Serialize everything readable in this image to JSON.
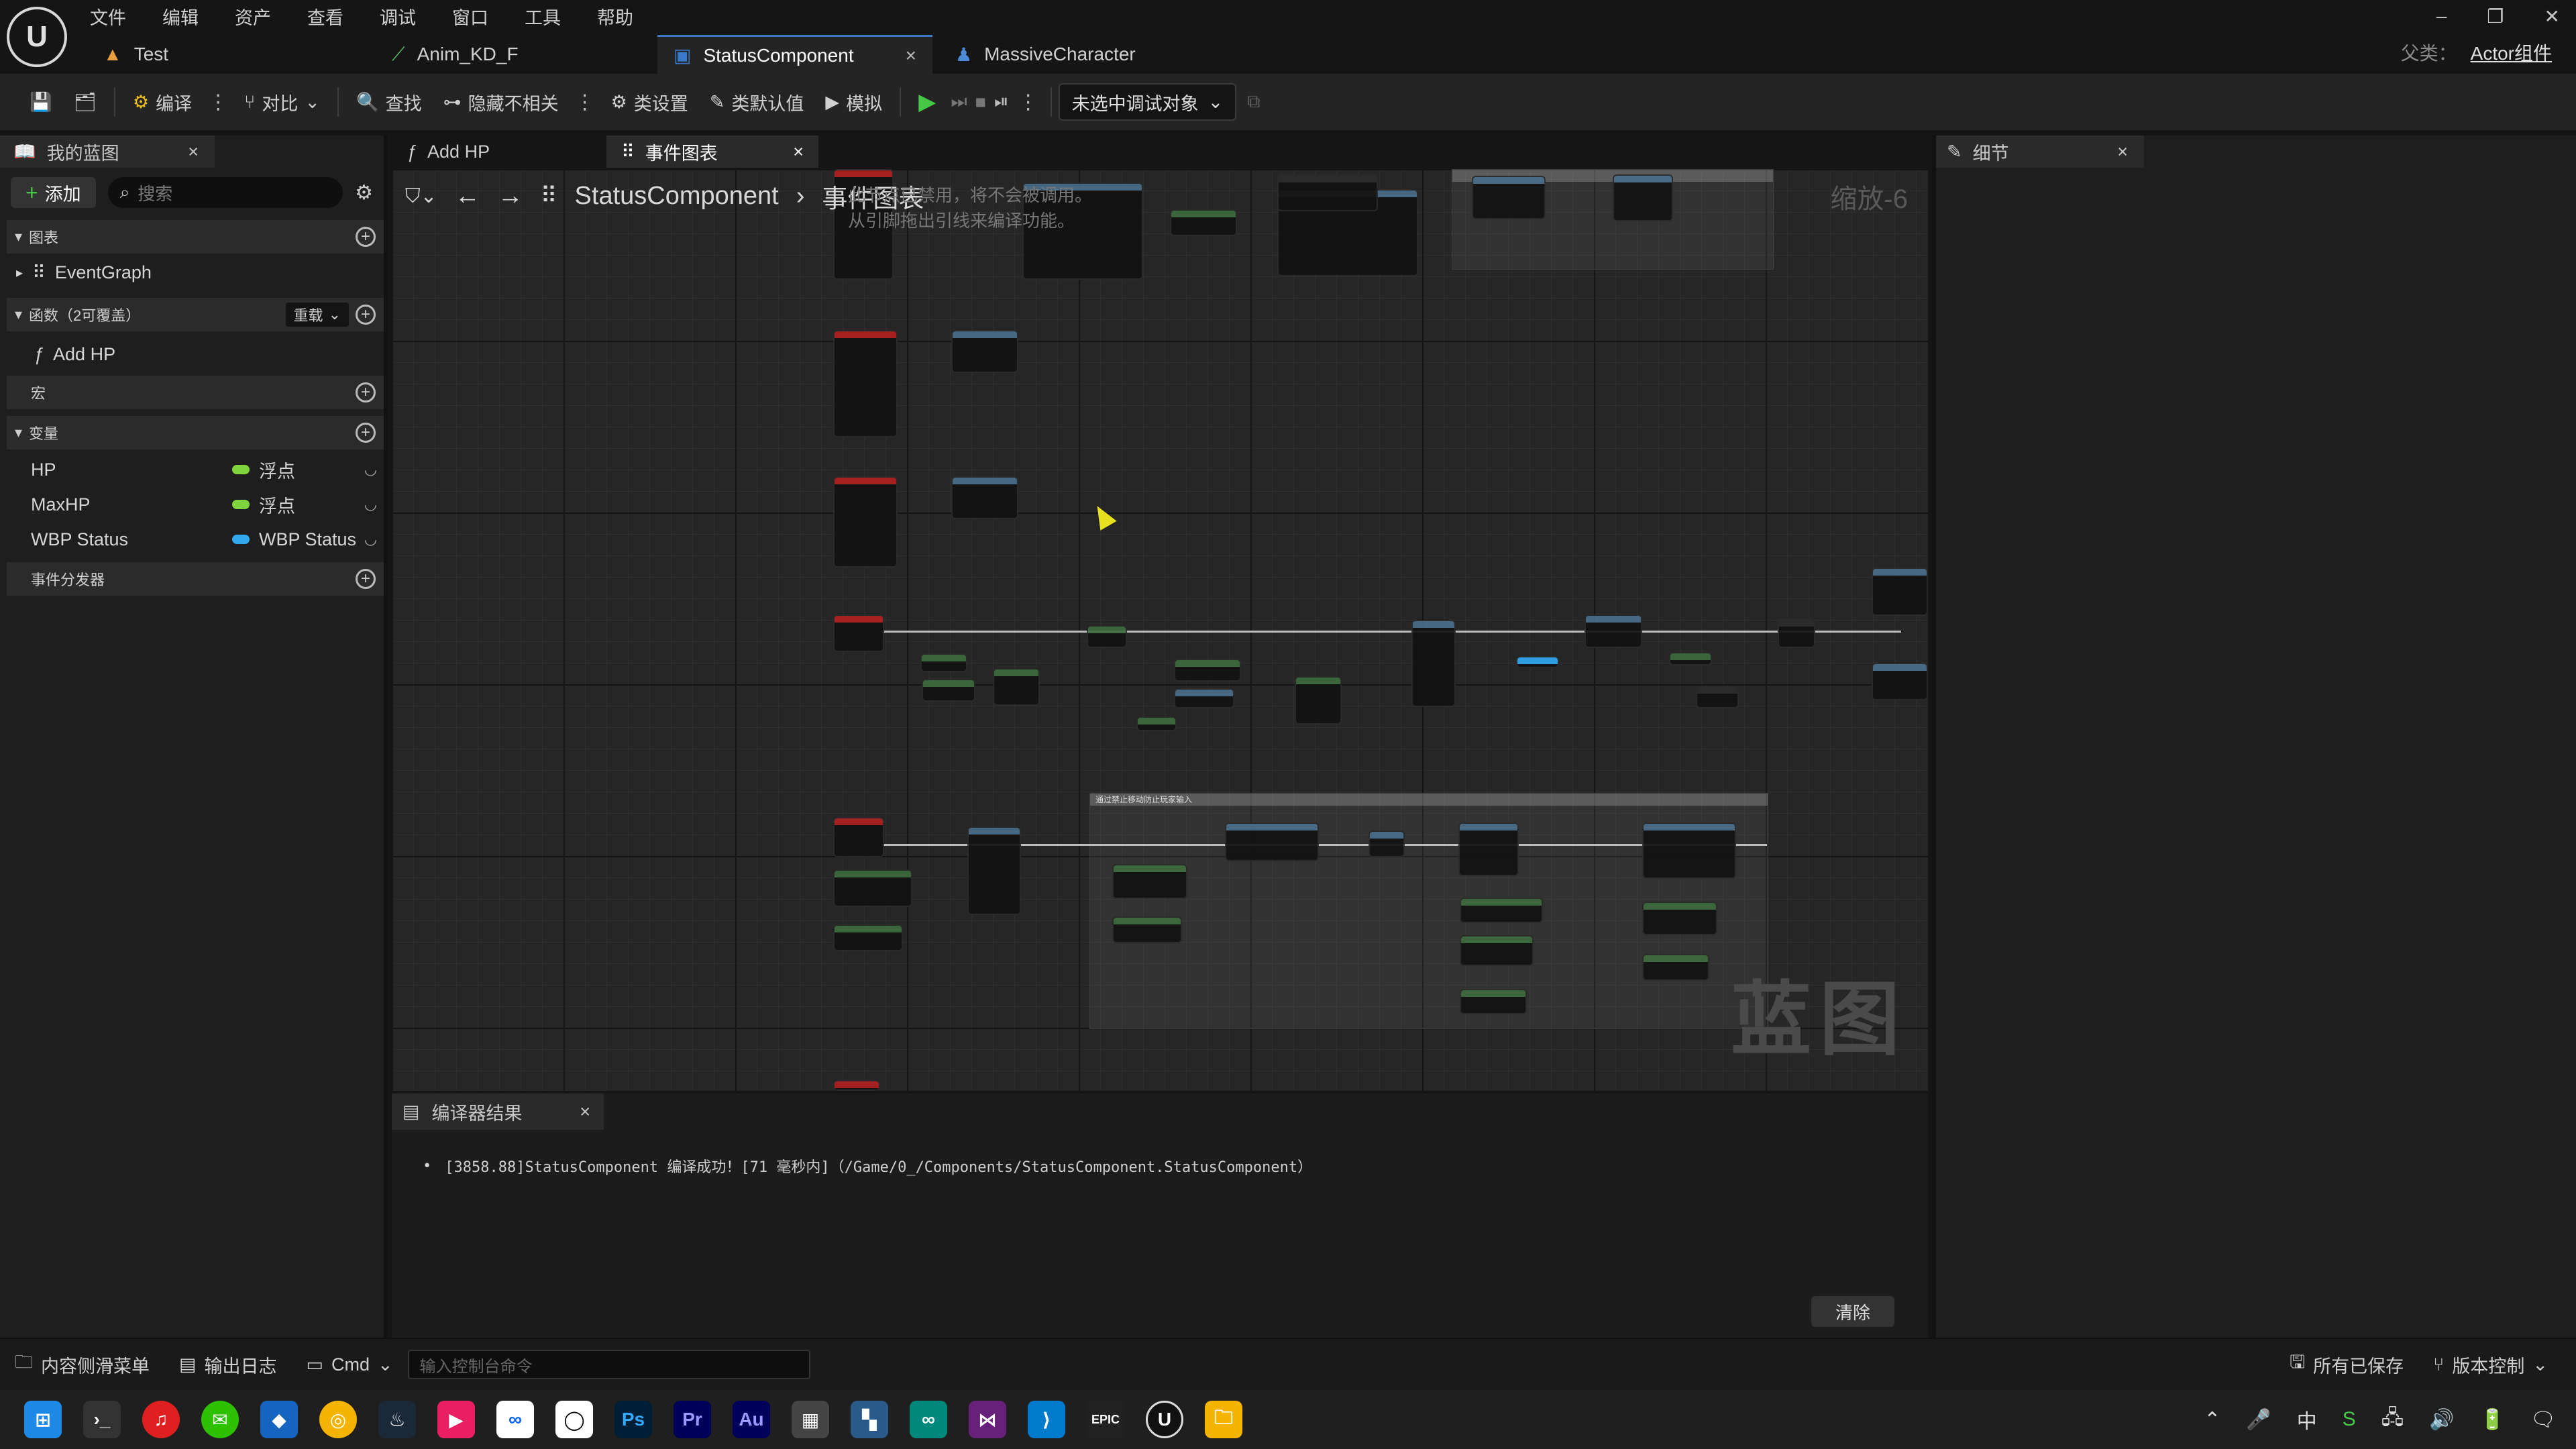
{
  "menu": [
    "文件",
    "编辑",
    "资产",
    "查看",
    "调试",
    "窗口",
    "工具",
    "帮助"
  ],
  "doc_tabs": [
    {
      "label": "Test"
    },
    {
      "label": "Anim_KD_F"
    },
    {
      "label": "StatusComponent"
    },
    {
      "label": "MassiveCharacter"
    }
  ],
  "parent_class": {
    "label": "父类：",
    "value": "Actor组件"
  },
  "toolbar": {
    "compile": "编译",
    "diff": "对比",
    "find": "查找",
    "hide_unrelated": "隐藏不相关",
    "class_settings": "类设置",
    "class_defaults": "类默认值",
    "simulate": "模拟",
    "debug_object": "未选中调试对象"
  },
  "my_blueprint": {
    "tab_label": "我的蓝图",
    "add_label": "添加",
    "search_placeholder": "搜索",
    "sections": {
      "graphs": "图表",
      "functions": "函数（2可覆盖）",
      "override": "重载",
      "macros": "宏",
      "variables": "变量",
      "dispatchers": "事件分发器"
    },
    "graph_items": [
      "EventGraph"
    ],
    "function_items": [
      "Add HP"
    ],
    "variables": [
      {
        "name": "HP",
        "type": "浮点",
        "color": "#7ed43a"
      },
      {
        "name": "MaxHP",
        "type": "浮点",
        "color": "#7ed43a"
      },
      {
        "name": "WBP Status",
        "type": "WBP Status",
        "color": "#31a8f0"
      }
    ]
  },
  "graph_tabs": [
    {
      "label": "Add HP"
    },
    {
      "label": "事件图表"
    }
  ],
  "graph": {
    "breadcrumb_root": "StatusComponent",
    "breadcrumb_current": "事件图表",
    "zoom": "缩放-6",
    "watermark": "蓝图",
    "compile_tip_line1": "此节点已禁用，将不会被调用。",
    "compile_tip_line2": "从引脚拖出引线来编译功能。",
    "comment_title": "通过禁止移动防止玩家输入"
  },
  "compiler": {
    "tab_label": "编译器结果",
    "message": "[3858.88]StatusComponent 编译成功！[71 毫秒内]（/Game/0_/Components/StatusComponent.StatusComponent）",
    "clear_label": "清除"
  },
  "details": {
    "tab_label": "细节"
  },
  "statusbar": {
    "content_drawer": "内容侧滑菜单",
    "output_log": "输出日志",
    "cmd": "Cmd",
    "console_placeholder": "输入控制台命令",
    "all_saved": "所有已保存",
    "source_control": "版本控制"
  },
  "tray": {
    "ime": "中"
  },
  "colors": {
    "event_node": "#b02020",
    "function_node": "#4a6e8a",
    "pure_node": "#3d6b3d",
    "accent": "#3a78c8"
  }
}
